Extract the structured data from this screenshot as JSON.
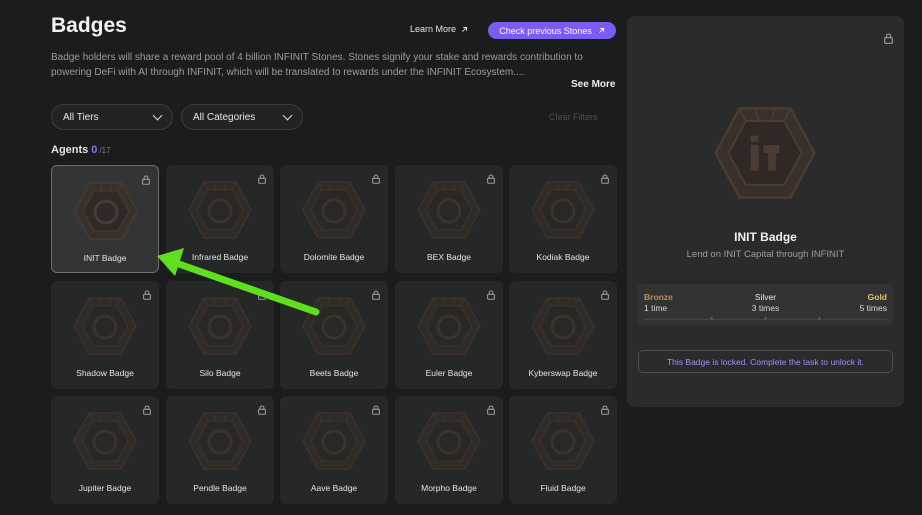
{
  "header": {
    "title": "Badges",
    "learn_more_label": "Learn More",
    "check_previous_label": "Check previous Stones"
  },
  "description": "Badge holders will share a reward pool of 4 billion INFINIT Stones. Stones signify your stake and rewards contribution to powering DeFi with AI through INFINIT, which will be translated to rewards under the INFINIT Ecosystem....",
  "see_more_label": "See More",
  "filters": {
    "tiers_label": "All Tiers",
    "categories_label": "All Categories",
    "clear_label": "Clear Filters"
  },
  "section": {
    "title": "Agents",
    "count": "0",
    "total": "/17"
  },
  "badges": [
    {
      "label": "INIT Badge",
      "icon": "init-icon",
      "active": true
    },
    {
      "label": "Infrared Badge",
      "icon": "infrared-icon"
    },
    {
      "label": "Dolomite Badge",
      "icon": "dolomite-icon"
    },
    {
      "label": "BEX Badge",
      "icon": "bex-icon"
    },
    {
      "label": "Kodiak Badge",
      "icon": "kodiak-icon"
    },
    {
      "label": "Shadow Badge",
      "icon": "shadow-icon"
    },
    {
      "label": "Silo Badge",
      "icon": "silo-icon"
    },
    {
      "label": "Beets Badge",
      "icon": "beets-icon"
    },
    {
      "label": "Euler Badge",
      "icon": "euler-icon"
    },
    {
      "label": "Kyberswap Badge",
      "icon": "kyberswap-icon"
    },
    {
      "label": "Jupiter Badge",
      "icon": "jupiter-icon"
    },
    {
      "label": "Pendle Badge",
      "icon": "pendle-icon"
    },
    {
      "label": "Aave Badge",
      "icon": "aave-icon"
    },
    {
      "label": "Morpho Badge",
      "icon": "morpho-icon"
    },
    {
      "label": "Fluid Badge",
      "icon": "fluid-icon"
    }
  ],
  "detail": {
    "title": "INIT Badge",
    "subtitle": "Lend on INIT Capital through INFINIT",
    "tiers": [
      {
        "name": "Bronze",
        "value": "1 time",
        "color": "#c98a5c"
      },
      {
        "name": "Silver",
        "value": "3 times",
        "color": "#e6e6e6"
      },
      {
        "name": "Gold",
        "value": "5 times",
        "color": "#e8c06a"
      }
    ],
    "locked_message": "This Badge is locked. Complete the task to unlock it."
  },
  "colors": {
    "accent": "#7b5cf0",
    "annotation_arrow": "#5fe01e"
  }
}
